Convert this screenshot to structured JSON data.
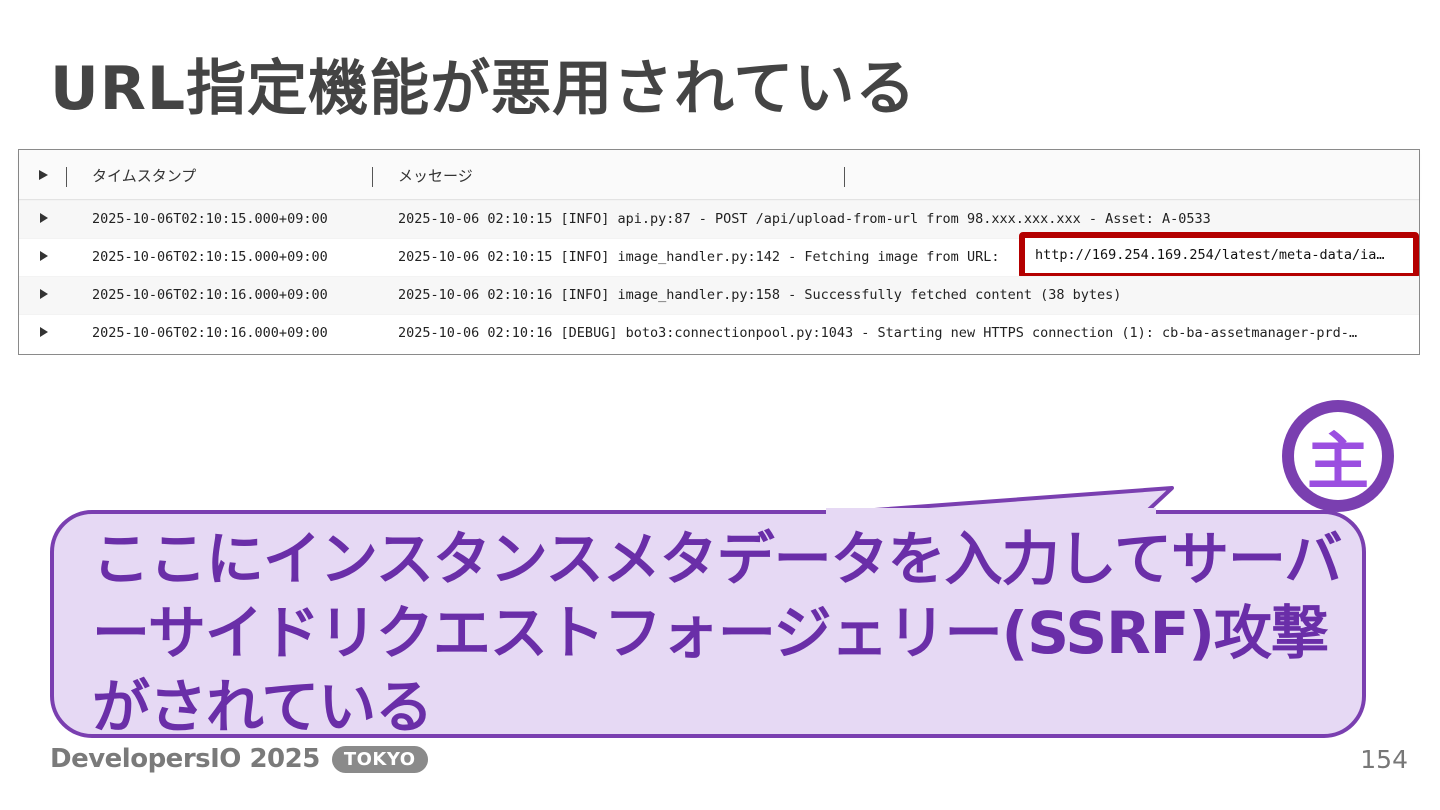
{
  "slide": {
    "title": "URL指定機能が悪用されている",
    "page_number": "154"
  },
  "log_table": {
    "columns": [
      "タイムスタンプ",
      "メッセージ"
    ],
    "rows": [
      {
        "timestamp": "2025-10-06T02:10:15.000+09:00",
        "message": "2025-10-06 02:10:15 [INFO] api.py:87 - POST /api/upload-from-url from 98.xxx.xxx.xxx - Asset: A-0533"
      },
      {
        "timestamp": "2025-10-06T02:10:15.000+09:00",
        "message": "2025-10-06 02:10:15 [INFO] image_handler.py:142 - Fetching image from URL:",
        "highlighted_url": "http://169.254.169.254/latest/meta-data/ia…"
      },
      {
        "timestamp": "2025-10-06T02:10:16.000+09:00",
        "message": "2025-10-06 02:10:16 [INFO] image_handler.py:158 - Successfully fetched content (38 bytes)"
      },
      {
        "timestamp": "2025-10-06T02:10:16.000+09:00",
        "message": "2025-10-06 02:10:16 [DEBUG] boto3:connectionpool.py:1043 - Starting new HTTPS connection (1): cb-ba-assetmanager-prd-…"
      }
    ],
    "highlight_color": "#b40000"
  },
  "callout": {
    "text": "ここにインスタンスメタデータを入力してサーバーサイドリクエストフォージェリー(SSRF)攻撃がされている",
    "badge": "主",
    "colors": {
      "fill": "#e6d9f4",
      "border": "#7a3fb0",
      "text": "#6a2ea8"
    }
  },
  "footer": {
    "brand": "DevelopersIO 2025",
    "brand_tag": "TOKYO"
  }
}
